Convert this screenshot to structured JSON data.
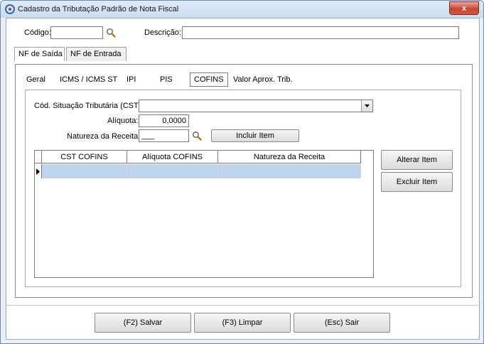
{
  "window": {
    "title": "Cadastro da Tributação Padrão de Nota Fiscal",
    "close_glyph": "x"
  },
  "header": {
    "codigo_label": "Código:",
    "codigo_value": "",
    "descricao_label": "Descrição:",
    "descricao_value": ""
  },
  "outer_tabs": [
    {
      "label": "NF de Saída",
      "active": true
    },
    {
      "label": "NF de Entrada",
      "active": false
    }
  ],
  "inner_tabs": [
    {
      "label": "Geral"
    },
    {
      "label": "ICMS / ICMS ST"
    },
    {
      "label": "IPI"
    },
    {
      "label": "PIS"
    },
    {
      "label": "COFINS",
      "active": true
    },
    {
      "label": "Valor Aprox. Trib."
    }
  ],
  "cofins": {
    "cst_label": "Cód. Situação Tributária (CST):",
    "cst_value": "",
    "aliquota_label": "Alíquota:",
    "aliquota_value": "0,0000",
    "natureza_label": "Natureza da Receita:",
    "natureza_value": "___",
    "incluir_label": "Incluir Item",
    "alterar_label": "Alterar Item",
    "excluir_label": "Excluir Item"
  },
  "grid": {
    "columns": [
      "CST COFINS",
      "Alíquota COFINS",
      "Natureza da Receita"
    ]
  },
  "footer": {
    "salvar_label": "(F2) Salvar",
    "limpar_label": "(F3) Limpar",
    "sair_label": "(Esc) Sair"
  }
}
